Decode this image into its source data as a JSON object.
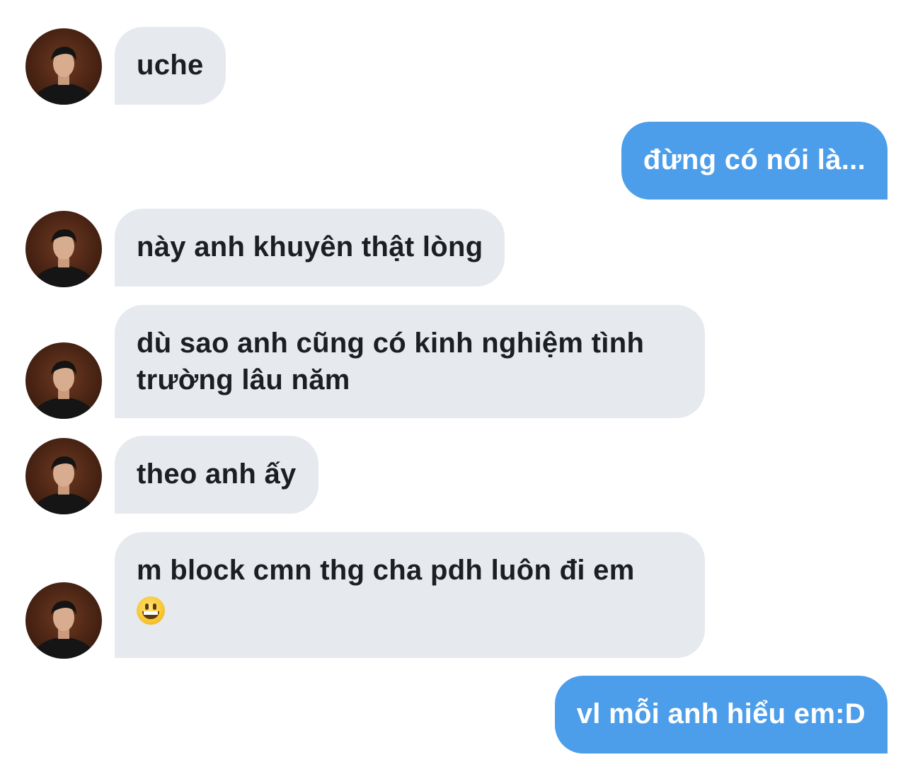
{
  "contact": {
    "avatar_icon": "user-avatar-photo",
    "accent_color": "#4c9eea",
    "incoming_bubble_color": "#e6eaee"
  },
  "messages": [
    {
      "direction": "incoming",
      "text": "uche"
    },
    {
      "direction": "outgoing",
      "text": "đừng có nói là..."
    },
    {
      "direction": "incoming",
      "text": "này anh khuyên thật lòng"
    },
    {
      "direction": "incoming",
      "text": "dù sao anh cũng có kinh nghiệm tình trường lâu năm"
    },
    {
      "direction": "incoming",
      "text": "theo anh ấy"
    },
    {
      "direction": "incoming",
      "text": "m block cmn thg cha pdh luôn đi em",
      "emoji": "grinning-face-emoji"
    },
    {
      "direction": "outgoing",
      "text": "vl mỗi anh hiểu em:D"
    }
  ]
}
